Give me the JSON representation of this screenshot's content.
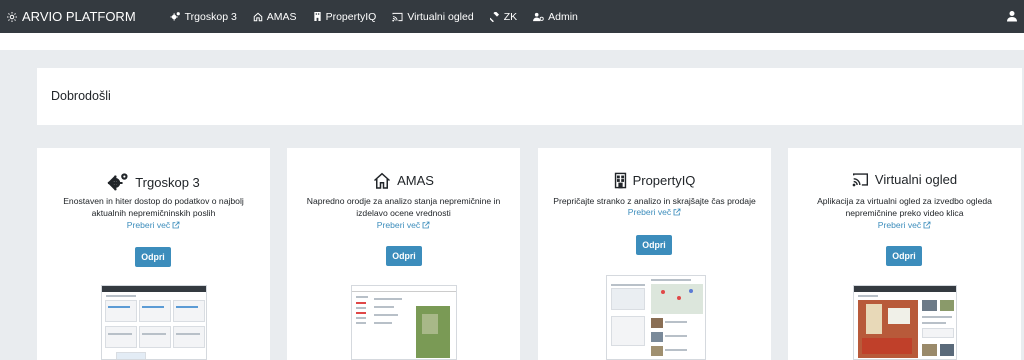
{
  "app": {
    "title": "ARVIO PLATFORM"
  },
  "nav": {
    "items": [
      {
        "label": "Trgoskop 3",
        "icon": "cogs-icon"
      },
      {
        "label": "AMAS",
        "icon": "home-icon"
      },
      {
        "label": "PropertyIQ",
        "icon": "building-icon"
      },
      {
        "label": "Virtualni ogled",
        "icon": "cast-icon"
      },
      {
        "label": "ZK",
        "icon": "gavel-icon"
      },
      {
        "label": "Admin",
        "icon": "users-cog-icon"
      }
    ],
    "user_icon": "user-icon"
  },
  "welcome": {
    "text": "Dobrodošli"
  },
  "cards": [
    {
      "title": "Trgoskop 3",
      "icon": "cogs-icon",
      "description_lines": [
        "Enostaven in hiter dostop do podatkov o najbolj",
        "aktualnih nepremičninskih poslih"
      ],
      "link": "Preberi več",
      "button": "Odpri"
    },
    {
      "title": "AMAS",
      "icon": "home-icon",
      "description_lines": [
        "Napredno orodje za analizo stanja nepremičnine in",
        "izdelavo ocene vrednosti"
      ],
      "link": "Preberi več",
      "button": "Odpri"
    },
    {
      "title": "PropertyIQ",
      "icon": "building-icon",
      "description_lines": [
        "Prepričajte stranko z analizo in skrajšajte čas prodaje"
      ],
      "link": "Preberi več",
      "button": "Odpri"
    },
    {
      "title": "Virtualni ogled",
      "icon": "cast-icon",
      "description_lines": [
        "Aplikacija za virtualni ogled za izvedbo ogleda",
        "nepremičnine preko video klica"
      ],
      "link": "Preberi več",
      "button": "Odpri"
    }
  ],
  "colors": {
    "navbar": "#343a40",
    "accent": "#3c8dbc",
    "background": "#e9ecef"
  }
}
